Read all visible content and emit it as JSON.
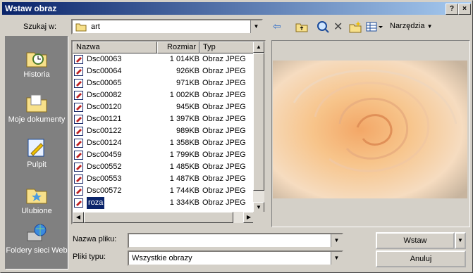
{
  "title": "Wstaw obraz",
  "title_buttons": {
    "help": "?",
    "close": "×"
  },
  "lookin": {
    "label": "Szukaj w:",
    "value": "art"
  },
  "toolbar": {
    "tools": "Narzędzia"
  },
  "places": [
    {
      "label": "Historia",
      "icon": "history-icon"
    },
    {
      "label": "Moje dokumenty",
      "icon": "my-documents-icon"
    },
    {
      "label": "Pulpit",
      "icon": "desktop-icon"
    },
    {
      "label": "Ulubione",
      "icon": "favorites-icon"
    },
    {
      "label": "Foldery sieci Web",
      "icon": "web-folders-icon"
    }
  ],
  "columns": {
    "name": "Nazwa",
    "size": "Rozmiar",
    "type": "Typ"
  },
  "files": [
    {
      "name": "Dsc00063",
      "size": "1 014KB",
      "type": "Obraz JPEG"
    },
    {
      "name": "Dsc00064",
      "size": "926KB",
      "type": "Obraz JPEG"
    },
    {
      "name": "Dsc00065",
      "size": "971KB",
      "type": "Obraz JPEG"
    },
    {
      "name": "Dsc00082",
      "size": "1 002KB",
      "type": "Obraz JPEG"
    },
    {
      "name": "Dsc00120",
      "size": "945KB",
      "type": "Obraz JPEG"
    },
    {
      "name": "Dsc00121",
      "size": "1 397KB",
      "type": "Obraz JPEG"
    },
    {
      "name": "Dsc00122",
      "size": "989KB",
      "type": "Obraz JPEG"
    },
    {
      "name": "Dsc00124",
      "size": "1 358KB",
      "type": "Obraz JPEG"
    },
    {
      "name": "Dsc00459",
      "size": "1 799KB",
      "type": "Obraz JPEG"
    },
    {
      "name": "Dsc00552",
      "size": "1 485KB",
      "type": "Obraz JPEG"
    },
    {
      "name": "Dsc00553",
      "size": "1 487KB",
      "type": "Obraz JPEG"
    },
    {
      "name": "Dsc00572",
      "size": "1 744KB",
      "type": "Obraz JPEG"
    },
    {
      "name": "roza",
      "size": "1 334KB",
      "type": "Obraz JPEG",
      "selected": true
    }
  ],
  "filename": {
    "label": "Nazwa pliku:",
    "value": ""
  },
  "filetype": {
    "label": "Pliki typu:",
    "value": "Wszystkie obrazy"
  },
  "buttons": {
    "insert": "Wstaw",
    "cancel": "Anuluj"
  },
  "colors": {
    "title_start": "#0a246a",
    "title_end": "#a6caf0",
    "selection": "#0a246a",
    "rose": "#f7c48a"
  }
}
